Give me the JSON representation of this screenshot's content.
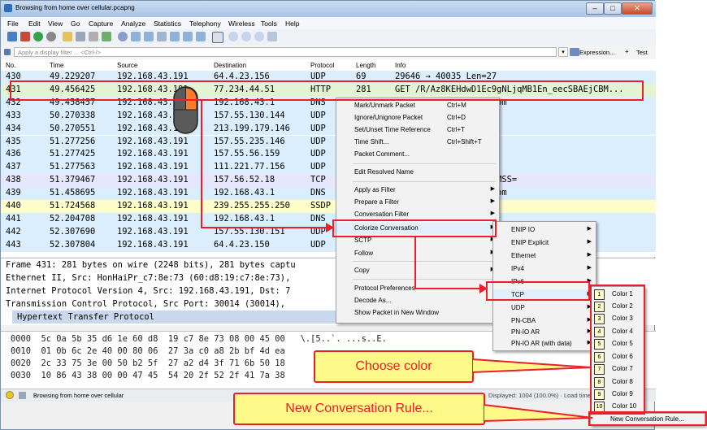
{
  "window": {
    "title": "Browsing from home over cellular.pcapng",
    "minimize": "–",
    "maximize": "□",
    "close": "✕"
  },
  "menubar": [
    "File",
    "Edit",
    "View",
    "Go",
    "Capture",
    "Analyze",
    "Statistics",
    "Telephony",
    "Wireless",
    "Tools",
    "Help"
  ],
  "filter": {
    "placeholder": "Apply a display filter ... <Ctrl-/>",
    "expression_label": "Expression...",
    "plus_label": "+",
    "test_label": "Test"
  },
  "columns": {
    "no": "No.",
    "time": "Time",
    "source": "Source",
    "destination": "Destination",
    "protocol": "Protocol",
    "length": "Length",
    "info": "Info"
  },
  "packets": [
    {
      "no": "430",
      "time": "49.229207",
      "src": "192.168.43.191",
      "dst": "64.4.23.156",
      "proto": "UDP",
      "len": "69",
      "info": "29646 → 40035  Len=27",
      "bg": "#daeefe"
    },
    {
      "no": "431",
      "time": "49.456425",
      "src": "192.168.43.191",
      "dst": "77.234.44.51",
      "proto": "HTTP",
      "len": "281",
      "info": "GET /R/Az8KEHdwD1Ec9gNLjqMB1En_eecSBAEjCBM...",
      "bg": "#e2f4d2"
    },
    {
      "no": "432",
      "time": "49.458457",
      "src": "192.168.43.191",
      "dst": "192.168.43.1",
      "proto": "DNS",
      "len": "",
      "info": "bf5 A dns.msftncsi.com",
      "bg": "#daeefe"
    },
    {
      "no": "433",
      "time": "50.270338",
      "src": "192.168.43.191",
      "dst": "157.55.130.144",
      "proto": "UDP",
      "len": "",
      "info": "=35",
      "bg": "#daeefe"
    },
    {
      "no": "434",
      "time": "50.270551",
      "src": "192.168.43.191",
      "dst": "213.199.179.146",
      "proto": "UDP",
      "len": "",
      "info": "=35",
      "bg": "#daeefe"
    },
    {
      "no": "435",
      "time": "51.277256",
      "src": "192.168.43.191",
      "dst": "157.55.235.146",
      "proto": "UDP",
      "len": "",
      "info": "=35",
      "bg": "#daeefe"
    },
    {
      "no": "436",
      "time": "51.277425",
      "src": "192.168.43.191",
      "dst": "157.55.56.159",
      "proto": "UDP",
      "len": "",
      "info": "=30",
      "bg": "#daeefe"
    },
    {
      "no": "437",
      "time": "51.277563",
      "src": "192.168.43.191",
      "dst": "111.221.77.156",
      "proto": "UDP",
      "len": "",
      "info": "=36",
      "bg": "#daeefe"
    },
    {
      "no": "438",
      "time": "51.379467",
      "src": "192.168.43.191",
      "dst": "157.56.52.18",
      "proto": "TCP",
      "len": "",
      "info": "eq=0 Win=8192 Len=0 MSS=",
      "bg": "#e7e6ff"
    },
    {
      "no": "439",
      "time": "51.458695",
      "src": "192.168.43.191",
      "dst": "192.168.43.1",
      "proto": "DNS",
      "len": "",
      "info": "bf5 A dns.msftncsi.com",
      "bg": "#daeefe"
    },
    {
      "no": "440",
      "time": "51.724568",
      "src": "192.168.43.191",
      "dst": "239.255.255.250",
      "proto": "SSDP",
      "len": "",
      "info": "1",
      "bg": "#fdfdcc"
    },
    {
      "no": "441",
      "time": "52.204708",
      "src": "192.168.43.191",
      "dst": "192.168.43.1",
      "proto": "DNS",
      "len": "",
      "info": "i.com",
      "bg": "#daeefe"
    },
    {
      "no": "442",
      "time": "52.307690",
      "src": "192.168.43.191",
      "dst": "157.55.130.151",
      "proto": "UDP",
      "len": "",
      "info": "",
      "bg": "#daeefe"
    },
    {
      "no": "443",
      "time": "52.307804",
      "src": "192.168.43.191",
      "dst": "64.4.23.150",
      "proto": "UDP",
      "len": "",
      "info": "",
      "bg": "#daeefe"
    }
  ],
  "details": [
    "Frame 431: 281 bytes on wire (2248 bits), 281 bytes captu",
    "Ethernet II, Src: HonHaiPr_c7:8e:73 (60:d8:19:c7:8e:73),",
    "Internet Protocol Version 4, Src: 192.168.43.191, Dst: 7",
    "Transmission Control Protocol, Src Port: 30014 (30014),",
    "Hypertext Transfer Protocol"
  ],
  "hex": [
    "0000  5c 0a 5b 35 d6 1e 60 d8  19 c7 8e 73 08 00 45 00   \\.[5..`. ...s..E.",
    "0010  01 0b 6c 2e 40 00 80 06  27 3a c0 a8 2b bf 4d ea",
    "0020  2c 33 75 3e 00 50 b2 5f  27 a2 d4 3f 71 6b 50 18",
    "0030  10 86 43 38 00 00 47 45  54 20 2f 52 2f 41 7a 38"
  ],
  "status": {
    "file": "Browsing from home over cellular",
    "stats": "Displayed: 1004 (100.0%) · Load time: 0:0.46"
  },
  "context_menu": [
    {
      "label": "Mark/Unmark Packet",
      "shortcut": "Ctrl+M"
    },
    {
      "label": "Ignore/Unignore Packet",
      "shortcut": "Ctrl+D"
    },
    {
      "label": "Set/Unset Time Reference",
      "shortcut": "Ctrl+T"
    },
    {
      "label": "Time Shift...",
      "shortcut": "Ctrl+Shift+T"
    },
    {
      "label": "Packet Comment...",
      "shortcut": ""
    },
    {
      "label": "Edit Resolved Name",
      "shortcut": ""
    },
    {
      "label": "Apply as Filter",
      "shortcut": ""
    },
    {
      "label": "Prepare a Filter",
      "shortcut": ""
    },
    {
      "label": "Conversation Filter",
      "shortcut": ""
    },
    {
      "label": "Colorize Conversation",
      "shortcut": ""
    },
    {
      "label": "SCTP",
      "shortcut": ""
    },
    {
      "label": "Follow",
      "shortcut": ""
    },
    {
      "label": "Copy",
      "shortcut": ""
    },
    {
      "label": "Protocol Preferences",
      "shortcut": ""
    },
    {
      "label": "Decode As...",
      "shortcut": ""
    },
    {
      "label": "Show Packet in New Window",
      "shortcut": ""
    }
  ],
  "protocol_menu": [
    "ENIP IO",
    "ENIP Explicit",
    "Ethernet",
    "IPv4",
    "IPv6",
    "TCP",
    "UDP",
    "PN-CBA",
    "PN-IO AR",
    "PN-IO AR (with data)"
  ],
  "color_menu": {
    "items": [
      {
        "num": "1",
        "label": "Color 1"
      },
      {
        "num": "2",
        "label": "Color 2"
      },
      {
        "num": "3",
        "label": "Color 3"
      },
      {
        "num": "4",
        "label": "Color 4"
      },
      {
        "num": "5",
        "label": "Color 5"
      },
      {
        "num": "6",
        "label": "Color 6"
      },
      {
        "num": "7",
        "label": "Color 7"
      },
      {
        "num": "8",
        "label": "Color 8"
      },
      {
        "num": "9",
        "label": "Color 9"
      },
      {
        "num": "10",
        "label": "Color 10"
      }
    ],
    "new_rule": "New Conversation Rule..."
  },
  "callouts": {
    "choose_color": "Choose color",
    "new_rule": "New Conversation Rule..."
  },
  "colors": {
    "highlight": "#e8202a",
    "callout_bg": "#fff989",
    "selection": "#3399ff"
  }
}
